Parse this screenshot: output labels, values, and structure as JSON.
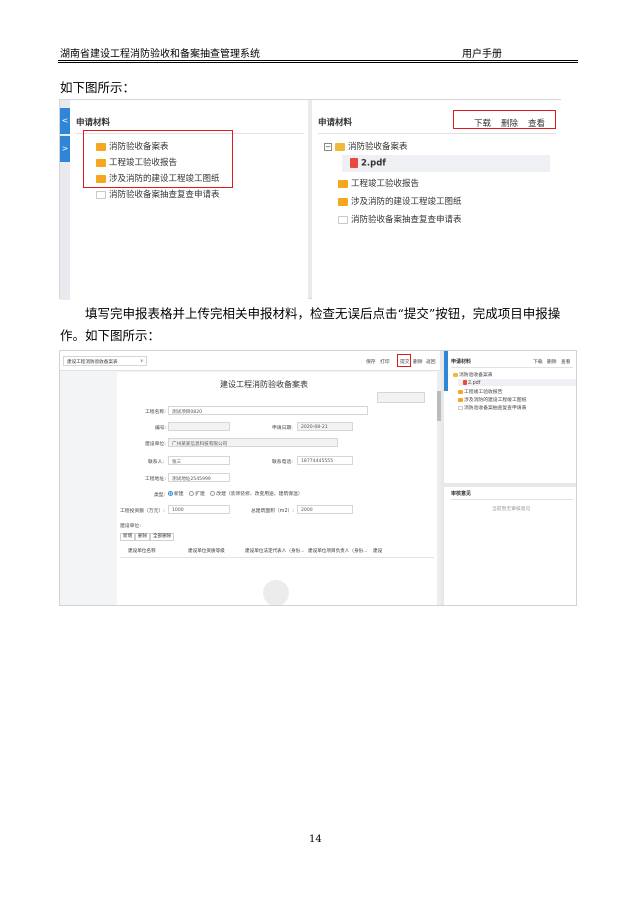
{
  "header": {
    "system_name": "湖南省建设工程消防验收和备案抽查管理系统",
    "doc_type": "用户手册"
  },
  "body": {
    "para1": "如下图所示：",
    "para2": "填写完申报表格并上传完相关申报材料，检查无误后点击“提交”按钮，完成项目申报操作。如下图所示："
  },
  "screenshot1": {
    "left_panel": {
      "title": "申请材料",
      "tab1": "<",
      "tab2": ">",
      "items": [
        "消防验收备案表",
        "工程竣工验收报告",
        "涉及消防的建设工程竣工图纸",
        "消防验收备案抽查复查申请表"
      ]
    },
    "right_panel": {
      "title": "申请材料",
      "buttons": [
        "下载",
        "删除",
        "查看"
      ],
      "tree_root": "消防验收备案表",
      "tree_file": "2.pdf",
      "items": [
        "工程竣工验收报告",
        "涉及消防的建设工程竣工图纸",
        "消防验收备案抽查复查申请表"
      ]
    }
  },
  "screenshot2": {
    "topbar": {
      "dropdown": "建设工程消防验收备案表",
      "dropdown_arrow": "∨",
      "actions": [
        "保存",
        "打印",
        "提交",
        "删除",
        "返回"
      ]
    },
    "form": {
      "title": "建设工程消防验收备案表",
      "project_name_label": "工程名称:",
      "project_name_value": "测试项目0820",
      "number_label": "编号:",
      "number_value": "",
      "apply_date_label": "申请日期:",
      "apply_date_value": "2020-08-21",
      "builder_label": "建设单位:",
      "builder_value": "广州某某信息科技有限公司",
      "contact_label": "联系人:",
      "contact_value": "张三",
      "phone_label": "联系电话:",
      "phone_value": "18774445555",
      "address_label": "工程地址:",
      "address_value": "测试地址2545999",
      "type_label": "类型:",
      "type_options": [
        "新建",
        "扩建",
        "改建（装饰装修、改变用途、建筑保温）"
      ],
      "invest_label": "工程投资额（万元）:",
      "invest_value": "1000",
      "area_label": "总建筑面积（m2）:",
      "area_value": "2000",
      "unit_label": "建设单位:",
      "table_buttons": [
        "新增",
        "删除",
        "全部删除"
      ],
      "table_headers": [
        "建设单位名称",
        "建设单位资质等级",
        "建设单位法定代表人（身份...",
        "建设单位项目负责人（身份...",
        "建设"
      ]
    },
    "side": {
      "title": "申请材料",
      "buttons": [
        "下载",
        "删除",
        "查看"
      ],
      "tree_root": "消防验收备案表",
      "tree_file": "2.pdf",
      "items": [
        "工程竣工验收报告",
        "涉及消防的建设工程竣工图纸",
        "消防验收备案抽查复查申请表"
      ],
      "opinion_title": "审核意见",
      "opinion_empty": "当前暂无审核意见"
    }
  },
  "page_number": "14"
}
